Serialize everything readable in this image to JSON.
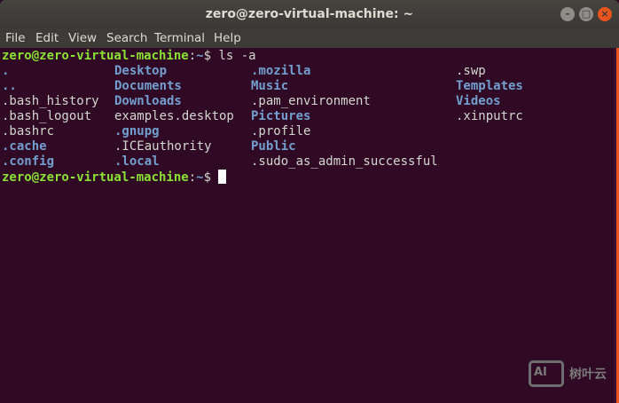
{
  "window": {
    "title": "zero@zero-virtual-machine: ~"
  },
  "menu": [
    "File",
    "Edit",
    "View",
    "Search",
    "Terminal",
    "Help"
  ],
  "terminal": {
    "prompt_user": "zero@zero-virtual-machine",
    "prompt_sep": ":",
    "prompt_path": "~",
    "prompt_dollar": "$ ",
    "command": "ls -a",
    "listing": [
      [
        {
          "t": ".",
          "d": true
        },
        {
          "t": "Desktop",
          "d": true
        },
        {
          "t": ".mozilla",
          "d": true
        },
        {
          "t": ".swp",
          "d": false
        }
      ],
      [
        {
          "t": "..",
          "d": true
        },
        {
          "t": "Documents",
          "d": true
        },
        {
          "t": "Music",
          "d": true
        },
        {
          "t": "Templates",
          "d": true
        }
      ],
      [
        {
          "t": ".bash_history",
          "d": false
        },
        {
          "t": "Downloads",
          "d": true
        },
        {
          "t": ".pam_environment",
          "d": false
        },
        {
          "t": "Videos",
          "d": true
        }
      ],
      [
        {
          "t": ".bash_logout",
          "d": false
        },
        {
          "t": "examples.desktop",
          "d": false
        },
        {
          "t": "Pictures",
          "d": true
        },
        {
          "t": ".xinputrc",
          "d": false
        }
      ],
      [
        {
          "t": ".bashrc",
          "d": false
        },
        {
          "t": ".gnupg",
          "d": true
        },
        {
          "t": ".profile",
          "d": false
        },
        null
      ],
      [
        {
          "t": ".cache",
          "d": true
        },
        {
          "t": ".ICEauthority",
          "d": false
        },
        {
          "t": "Public",
          "d": true
        },
        null
      ],
      [
        {
          "t": ".config",
          "d": true
        },
        {
          "t": ".local",
          "d": true
        },
        {
          "t": ".sudo_as_admin_successful",
          "d": false
        },
        null
      ]
    ]
  },
  "watermark": {
    "logo": "AI",
    "text": "树叶云"
  },
  "colors": {
    "bg": "#300a24",
    "prompt": "#8ae234",
    "dir": "#729fcf",
    "text": "#d3d7cf"
  }
}
